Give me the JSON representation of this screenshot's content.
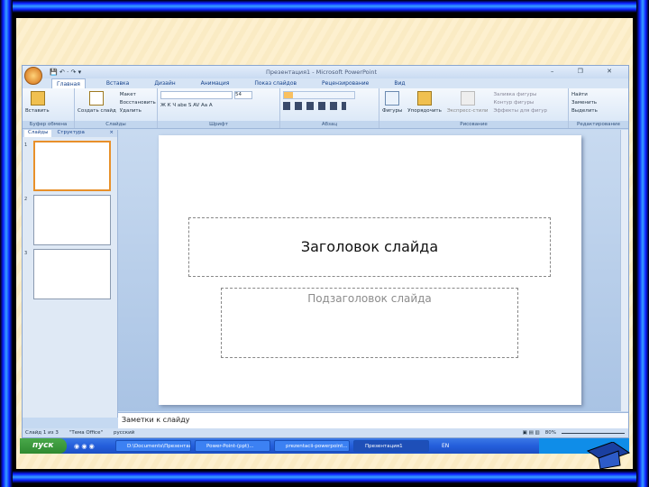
{
  "window": {
    "title": "Презентация1 - Microsoft PowerPoint",
    "qat": "💾 ↶ · ↷ ▾",
    "controls": "– ❐ ✕"
  },
  "tabs": [
    "Главная",
    "Вставка",
    "Дизайн",
    "Анимация",
    "Показ слайдов",
    "Рецензирование",
    "Вид"
  ],
  "ribbon": {
    "clipboard": {
      "paste": "Вставить",
      "label": "Буфер обмена"
    },
    "slides": {
      "new_slide": "Создать слайд",
      "layout": "Макет",
      "reset": "Восстановить",
      "delete": "Удалить",
      "label": "Слайды"
    },
    "font": {
      "size": "54",
      "label": "Шрифт",
      "format": "Ж К Ч abe S AV Aa A"
    },
    "paragraph": {
      "label": "Абзац"
    },
    "drawing": {
      "shapes": "Фигуры",
      "arrange": "Упорядочить",
      "quick_styles": "Экспресс-стили",
      "fill": "Заливка фигуры",
      "outline": "Контур фигуры",
      "effects": "Эффекты для фигур",
      "label": "Рисование"
    },
    "editing": {
      "find": "Найти",
      "replace": "Заменить",
      "select": "Выделить",
      "label": "Редактирование"
    }
  },
  "pane": {
    "tab_slides": "Слайды",
    "tab_outline": "Структура",
    "close": "×",
    "thumbs": [
      "1",
      "2",
      "3"
    ]
  },
  "slide": {
    "title": "Заголовок слайда",
    "subtitle": "Подзаголовок слайда"
  },
  "notes": "Заметки к слайду",
  "status": {
    "slide": "Слайд 1 из 3",
    "theme": "\"Тема Office\"",
    "lang": "русский",
    "zoom": "80%"
  },
  "taskbar": {
    "start": "пуск",
    "items": [
      "D:\\Documents\\Презентации...",
      "Power-Point-(ppt)...",
      "prezentacii-powerpoint...",
      "Презентация1"
    ],
    "lang": "EN"
  }
}
